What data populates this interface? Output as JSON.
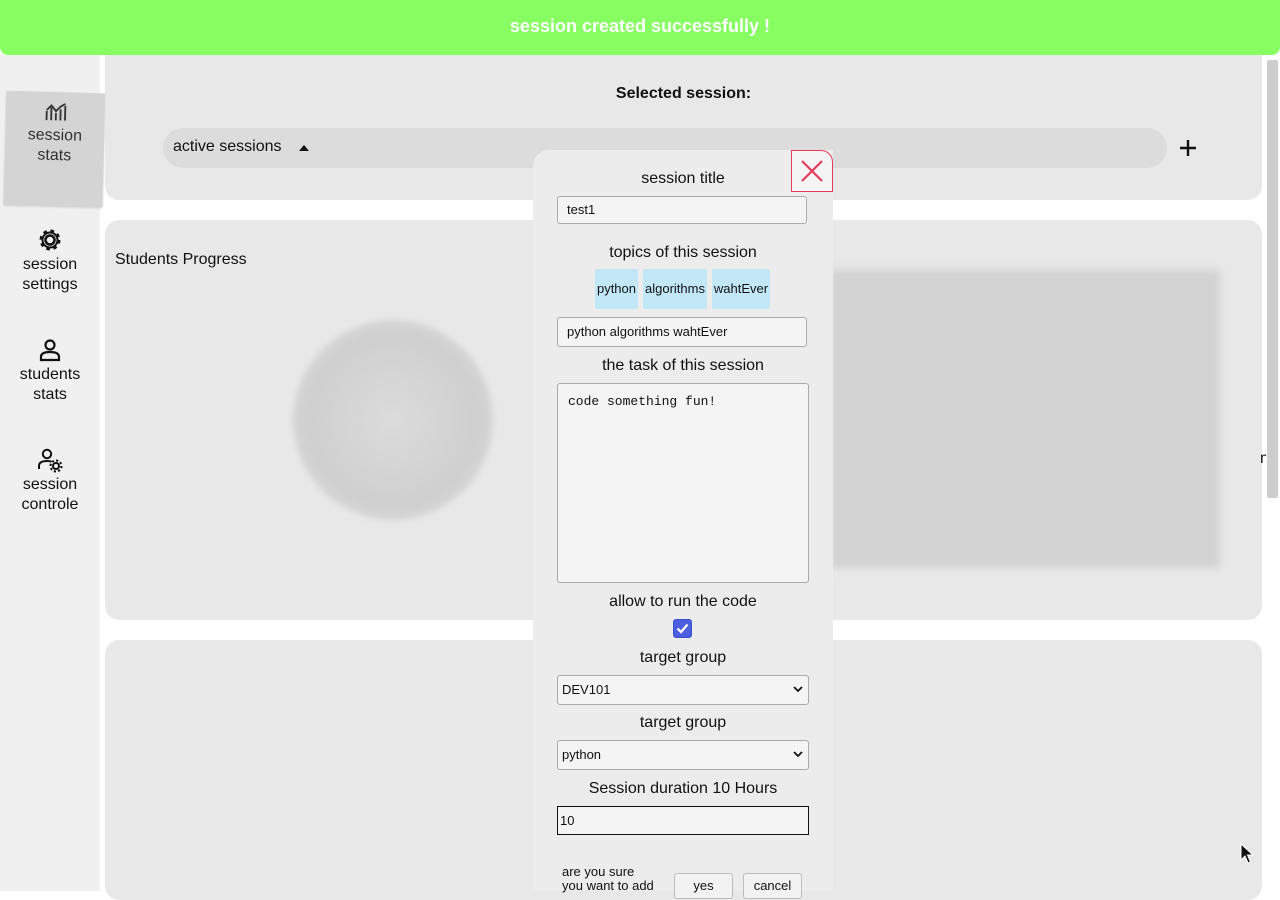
{
  "banner": {
    "message": "session created successfully !"
  },
  "sidebar": {
    "items": [
      {
        "label_line1": "session",
        "label_line2": "stats",
        "icon": "chart-icon"
      },
      {
        "label_line1": "session",
        "label_line2": "settings",
        "icon": "gear-icon"
      },
      {
        "label_line1": "students",
        "label_line2": "stats",
        "icon": "user-icon"
      },
      {
        "label_line1": "session",
        "label_line2": "controle",
        "icon": "user-gear-icon"
      }
    ]
  },
  "header": {
    "selected_session_label": "Selected session:",
    "active_sessions_label": "active sessions",
    "add_icon": "plus-icon"
  },
  "progress": {
    "title": "Students Progress",
    "edge_text": "me"
  },
  "modal": {
    "title_label": "session title",
    "title_value": "test1",
    "topics_label": "topics of this session",
    "topics": [
      "python",
      "algorithms",
      "wahtEver"
    ],
    "topics_value": "python algorithms wahtEver",
    "task_label": "the task of this session",
    "task_value": "code something fun!",
    "allow_run_label": "allow to run the code",
    "allow_run_checked": true,
    "group_label": "target group",
    "group_value": "DEV101",
    "language_label": "target group",
    "language_value": "python",
    "duration_label": "Session duration 10 Hours",
    "duration_value": "10",
    "confirm_line1": "are you sure",
    "confirm_line2": "you want to add",
    "yes_label": "yes",
    "cancel_label": "cancel"
  },
  "colors": {
    "banner": "#87ff63",
    "chip": "#c2e7f7",
    "close": "#e33b5a",
    "checkbox": "#4b5fe0"
  }
}
